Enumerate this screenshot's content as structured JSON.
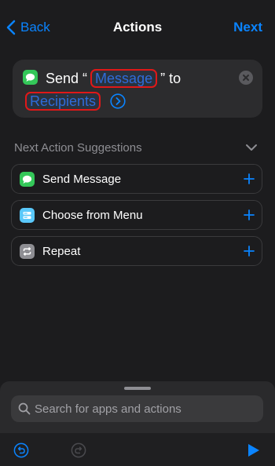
{
  "nav": {
    "back_label": "Back",
    "title": "Actions",
    "next_label": "Next"
  },
  "action": {
    "send_prefix": "Send “",
    "message_token": "Message",
    "to_text": "” to",
    "recipients_token": "Recipients"
  },
  "suggestions": {
    "title": "Next Action Suggestions",
    "items": [
      {
        "label": "Send Message",
        "icon": "messages-icon",
        "color": "#34c759"
      },
      {
        "label": "Choose from Menu",
        "icon": "menu-icon",
        "color": "#5ac8fa"
      },
      {
        "label": "Repeat",
        "icon": "repeat-icon",
        "color": "#8e8e93"
      }
    ]
  },
  "search": {
    "placeholder": "Search for apps and actions"
  },
  "colors": {
    "accent": "#0a84ff",
    "highlight": "#e01818",
    "background": "#1c1c1e"
  }
}
